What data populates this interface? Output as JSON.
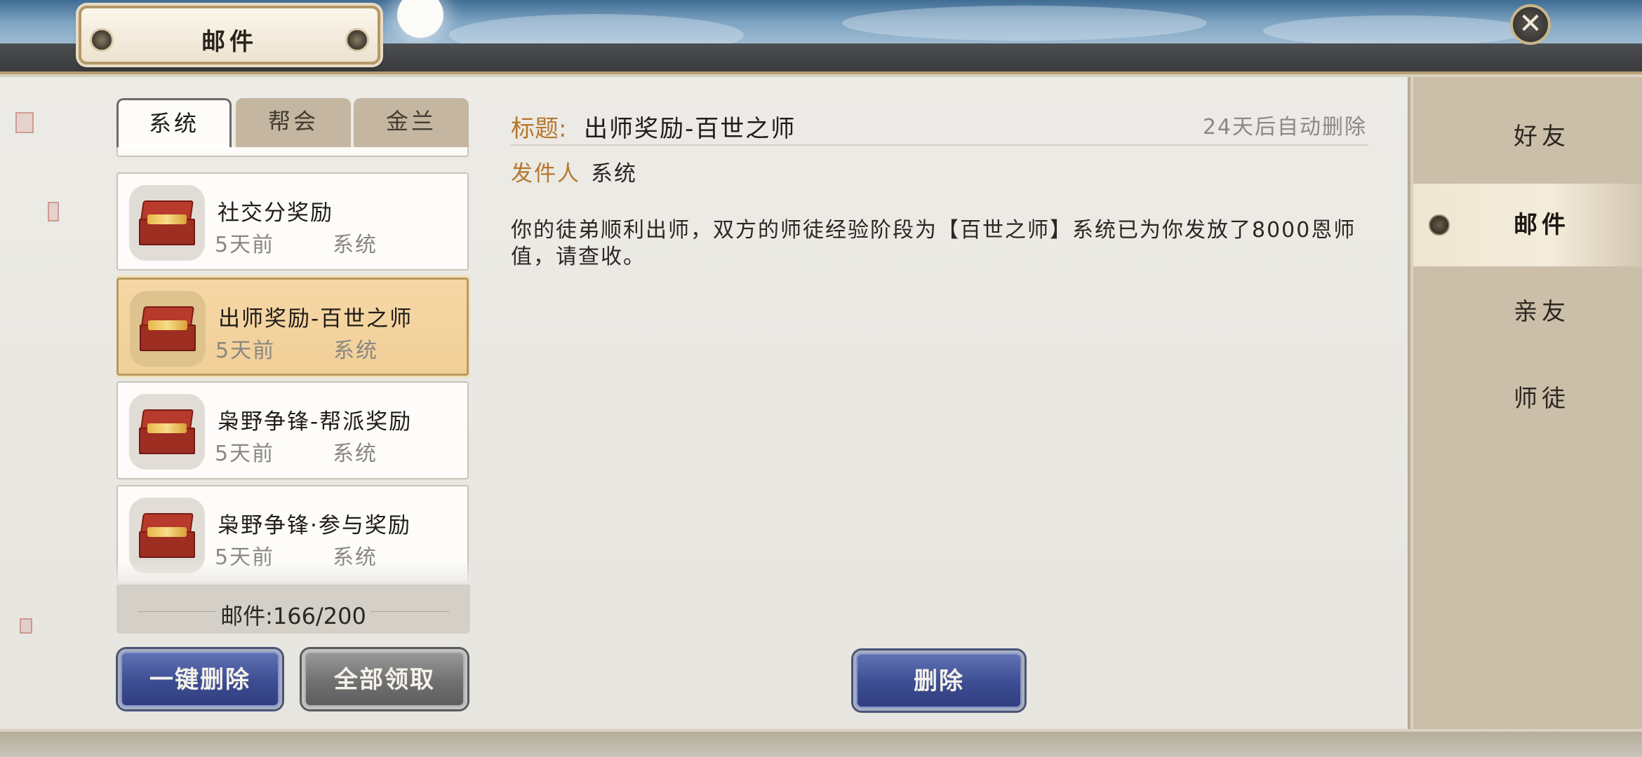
{
  "header": {
    "title": "邮件",
    "close_icon": "close-icon"
  },
  "tabs": [
    {
      "label": "系统",
      "active": true
    },
    {
      "label": "帮会",
      "active": false
    },
    {
      "label": "金兰",
      "active": false
    }
  ],
  "mail_list": {
    "items": [
      {
        "name": "社交分奖励",
        "time": "5天前",
        "sender": "系统",
        "icon": "treasure-chest-icon",
        "selected": false
      },
      {
        "name": "出师奖励-百世之师",
        "time": "5天前",
        "sender": "系统",
        "icon": "treasure-chest-icon",
        "selected": true
      },
      {
        "name": "枭野争锋-帮派奖励",
        "time": "5天前",
        "sender": "系统",
        "icon": "treasure-chest-icon",
        "selected": false
      },
      {
        "name": "枭野争锋·参与奖励",
        "time": "5天前",
        "sender": "系统",
        "icon": "treasure-chest-icon",
        "selected": false
      }
    ],
    "count_text": "邮件:166/200"
  },
  "actions": {
    "delete_all": "一键删除",
    "claim_all": "全部领取",
    "delete": "删除"
  },
  "detail": {
    "title_label": "标题:",
    "title": "出师奖励-百世之师",
    "expire": "24天后自动删除",
    "sender_label": "发件人",
    "sender": "系统",
    "body": "你的徒弟顺利出师，双方的师徒经验阶段为【百世之师】系统已为你发放了8000恩师值，请查收。"
  },
  "sidebar": {
    "items": [
      {
        "label": "好友",
        "active": false
      },
      {
        "label": "邮件",
        "active": true
      },
      {
        "label": "亲友",
        "active": false
      },
      {
        "label": "师徒",
        "active": false
      }
    ]
  },
  "colors": {
    "accent_gold": "#b5782c",
    "selected_bg": "#f6d7a5",
    "button_blue": "#3d4d92",
    "button_gray": "#707070"
  }
}
